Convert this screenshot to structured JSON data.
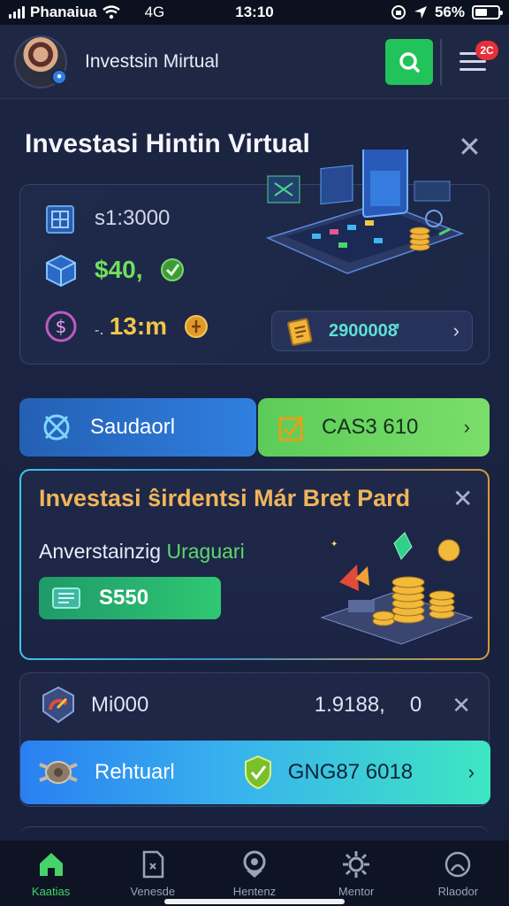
{
  "status_bar": {
    "carrier": "Phanaiua",
    "network": "4G",
    "time": "13:10",
    "battery_percent": "56%",
    "battery_level": 0.56
  },
  "header": {
    "title": "Investsin Mirtual",
    "avatar_icon": "user-avatar",
    "notification_count": "2C",
    "accent": "#22c35a"
  },
  "section": {
    "title": "Investasi Hintin Virtual"
  },
  "portfolio_card": {
    "rows": [
      {
        "icon": "cube-icon",
        "value": "s1:3000"
      },
      {
        "icon": "box-icon",
        "value": "$40,"
      },
      {
        "icon": "dollar-circle-icon",
        "prefix": "-․",
        "value": "13:m"
      }
    ],
    "balance_button": {
      "icon": "coin-document-icon",
      "value": "2900008̓"
    }
  },
  "tabs": [
    {
      "label": "Saudaorl",
      "icon": "target-icon"
    },
    {
      "label": "CAS3 610",
      "icon": "checkbox-icon"
    }
  ],
  "promo_card": {
    "title": "Investasi ŝirdentsi Már Bret Pard",
    "subtitle_main": "Anverstainzig ",
    "subtitle_highlight": "Uraguari",
    "button_label": "S550"
  },
  "position_card": {
    "name": "Mi000",
    "value": "1.9188,",
    "change": "0",
    "action_label": "Rehtuarl",
    "action_value": "GNG87 6018"
  },
  "bottom_nav": [
    {
      "label": "Kaatias",
      "icon": "home-icon"
    },
    {
      "label": "Venesde",
      "icon": "document-icon"
    },
    {
      "label": "Hentenz",
      "icon": "location-icon"
    },
    {
      "label": "Mentor",
      "icon": "settings-icon"
    },
    {
      "label": "Rlaodor",
      "icon": "profile-icon"
    }
  ]
}
